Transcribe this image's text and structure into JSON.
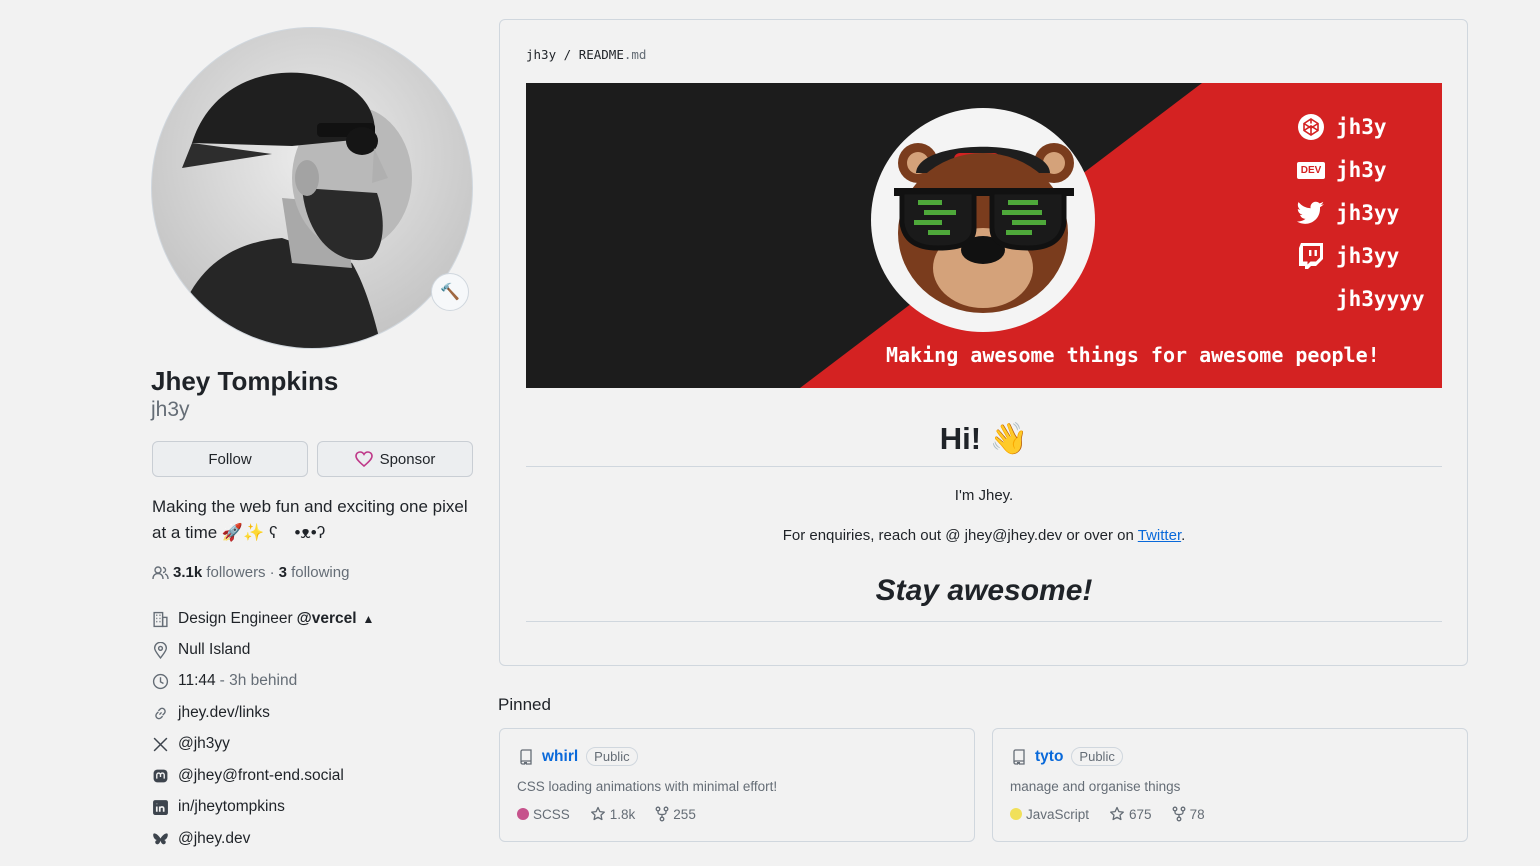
{
  "profile": {
    "display_name": "Jhey Tompkins",
    "username": "jh3y",
    "follow_label": "Follow",
    "sponsor_label": "Sponsor",
    "bio": "Making the web fun and exciting one pixel at a time 🚀✨ ʕ　•ᴥ•ʔ",
    "followers_count": "3.1k",
    "followers_label": "followers",
    "following_count": "3",
    "following_label": "following",
    "separator": "·",
    "status_emoji": "🔨",
    "details": {
      "job_title": "Design Engineer",
      "company": "@vercel",
      "company_logo": "▲",
      "location": "Null Island",
      "local_time": "11:44",
      "time_offset": "- 3h behind",
      "website": "jhey.dev/links",
      "x_handle": "@jh3yy",
      "mastodon": "@jhey@front-end.social",
      "linkedin": "in/jheytompkins",
      "bluesky": "@jhey.dev"
    }
  },
  "readme": {
    "owner": "jh3y",
    "path_sep": "/",
    "file_name": "README",
    "file_ext": ".md",
    "banner": {
      "codepen": "jh3y",
      "dev": "jh3y",
      "dev_badge": "DEV",
      "twitter": "jh3yy",
      "twitch": "jh3yy",
      "other": "jh3yyyy",
      "tagline": "Making awesome things for awesome people!"
    },
    "greeting": "Hi! 👋",
    "intro": "I'm Jhey.",
    "enquiry_prefix": "For enquiries, reach out @ jhey@jhey.dev or over on ",
    "twitter_link": "Twitter",
    "enquiry_suffix": ".",
    "signoff": "Stay awesome!"
  },
  "pinned": {
    "title": "Pinned",
    "repos": [
      {
        "name": "whirl",
        "visibility": "Public",
        "description": "CSS loading animations with minimal effort!",
        "language": "SCSS",
        "language_color": "#c6538c",
        "stars": "1.8k",
        "forks": "255"
      },
      {
        "name": "tyto",
        "visibility": "Public",
        "description": "manage and organise things",
        "language": "JavaScript",
        "language_color": "#f1e05a",
        "stars": "675",
        "forks": "78"
      }
    ]
  },
  "colors": {
    "accent": "#0969da",
    "banner_red": "#d42222",
    "banner_dark": "#1c1c1c",
    "sponsor_heart": "#bf3989"
  }
}
